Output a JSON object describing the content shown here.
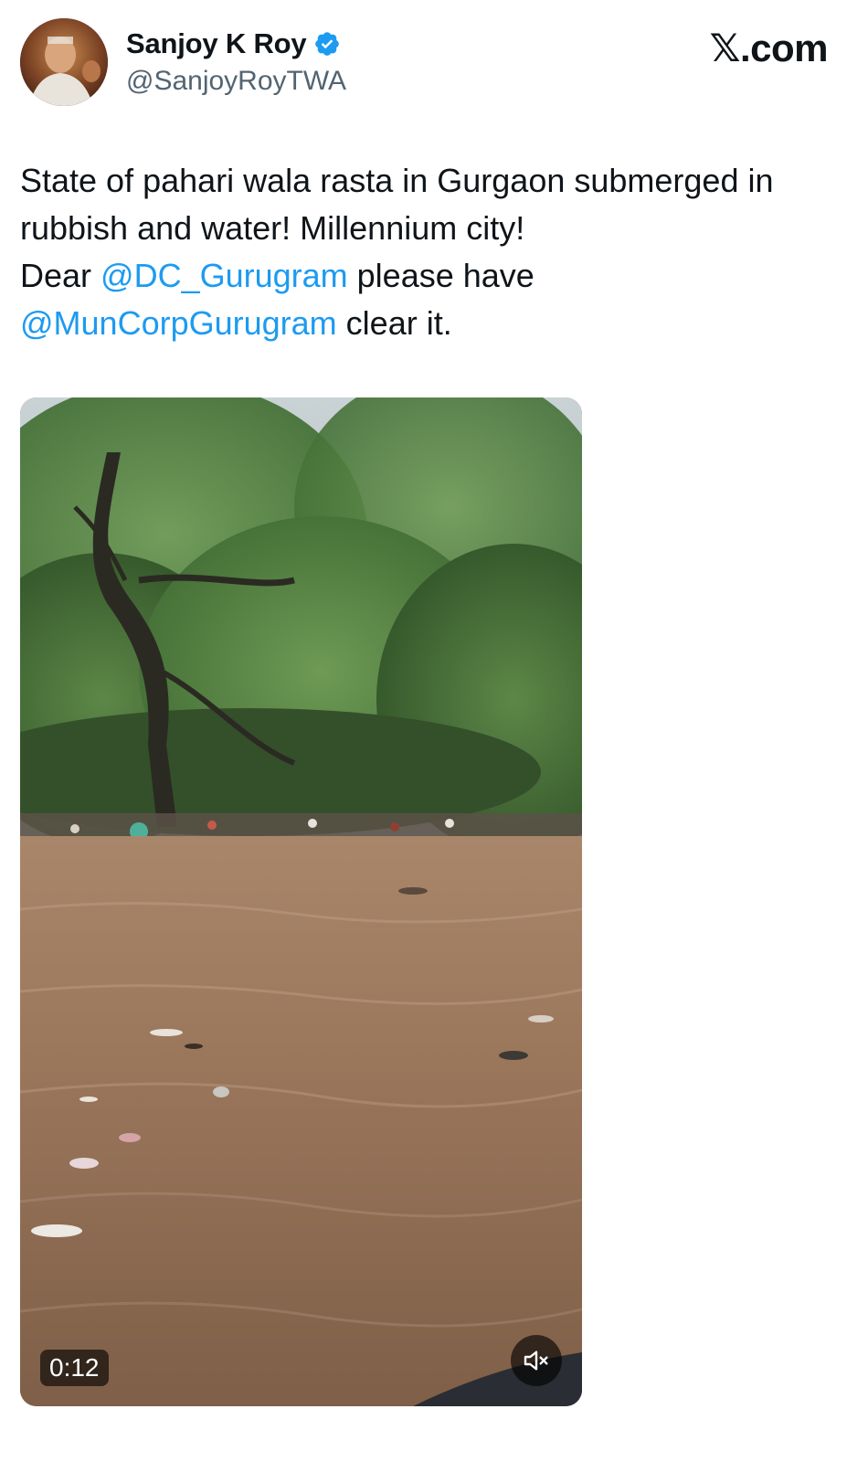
{
  "author": {
    "display_name": "Sanjoy K Roy",
    "handle": "@SanjoyRoyTWA",
    "verified": true
  },
  "site": {
    "logo_text": ".com",
    "logo_icon": "x-logo-icon"
  },
  "tweet": {
    "text_1": "State of pahari wala rasta in Gurgaon submerged in rubbish and water! Millennium city!",
    "text_2": "Dear ",
    "mention_1": "@DC_Gurugram",
    "text_3": " please have",
    "mention_2": "@MunCorpGurugram",
    "text_4": " clear it."
  },
  "media": {
    "type": "video",
    "duration": "0:12",
    "icons": {
      "mute": "volume-muted-icon"
    }
  },
  "colors": {
    "accent": "#1d9bf0",
    "text": "#0f1419",
    "secondary_text": "#536471"
  }
}
